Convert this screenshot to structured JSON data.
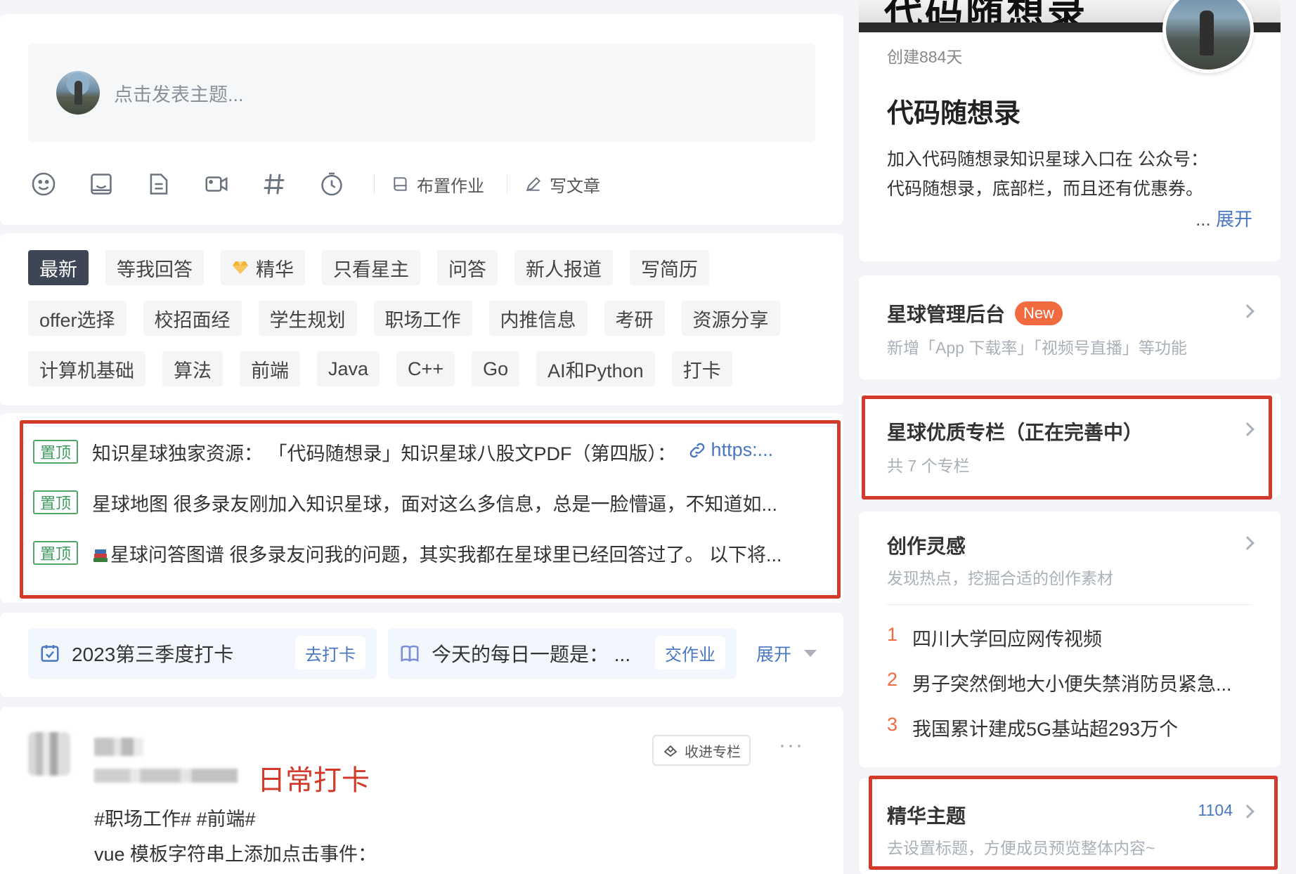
{
  "compose": {
    "placeholder": "点击发表主题...",
    "tools": [
      "emoji-icon",
      "image-icon",
      "file-icon",
      "video-icon",
      "hashtag-icon",
      "timer-icon"
    ],
    "assign_homework": "布置作业",
    "write_article": "写文章"
  },
  "tags": {
    "row1": [
      "最新",
      "等我回答",
      "精华",
      "只看星主",
      "问答",
      "新人报道",
      "写简历"
    ],
    "row2": [
      "offer选择",
      "校招面经",
      "学生规划",
      "职场工作",
      "内推信息",
      "考研",
      "资源分享"
    ],
    "row3": [
      "计算机基础",
      "算法",
      "前端",
      "Java",
      "C++",
      "Go",
      "AI和Python",
      "打卡"
    ]
  },
  "pinned": {
    "badge": "置顶",
    "items": [
      {
        "text": "知识星球独家资源：  「代码随想录」知识星球八股文PDF（第四版）：",
        "link": "https:..."
      },
      {
        "text": "星球地图 很多录友刚加入知识星球，面对这么多信息，总是一脸懵逼，不知道如..."
      },
      {
        "text": "星球问答图谱 很多录友问我的问题，其实我都在星球里已经回答过了。 以下将..."
      }
    ]
  },
  "checkin": {
    "task1": {
      "title": "2023第三季度打卡",
      "button": "去打卡"
    },
    "task2": {
      "title": "今天的每日一题是：  ...",
      "button": "交作业"
    },
    "expand": "展开"
  },
  "post": {
    "label": "日常打卡",
    "collect": "收进专栏",
    "more": "···",
    "tags": "#职场工作# #前端#",
    "body": "vue 模板字符串上添加点击事件："
  },
  "group": {
    "banner_text": "代码随想录",
    "created": "创建884天",
    "name": "代码随想录",
    "desc_line1": "加入代码随想录知识星球入口在 公众号：",
    "desc_line2": "代码随想录，底部栏，而且还有优惠券。",
    "expand_prefix": "... ",
    "expand": "展开"
  },
  "admin": {
    "title": "星球管理后台",
    "badge": "New",
    "sub": "新增「App 下载率」「视频号直播」等功能"
  },
  "columns": {
    "title": "星球优质专栏（正在完善中）",
    "sub": "共 7 个专栏"
  },
  "inspiration": {
    "title": "创作灵感",
    "sub": "发现热点，挖掘合适的创作素材",
    "items": [
      {
        "rank": "1",
        "text": "四川大学回应网传视频"
      },
      {
        "rank": "2",
        "text": "男子突然倒地大小便失禁消防员紧急..."
      },
      {
        "rank": "3",
        "text": "我国累计建成5G基站超293万个"
      }
    ]
  },
  "featured": {
    "title": "精华主题",
    "count": "1104",
    "sub": "去设置标题，方便成员预览整体内容~"
  },
  "colors": {
    "accent": "#4a77c3",
    "highlight": "#d23a2b",
    "tag_active": "#3c4655",
    "rank": "#f26a3f",
    "pin": "#3e9a5e"
  }
}
